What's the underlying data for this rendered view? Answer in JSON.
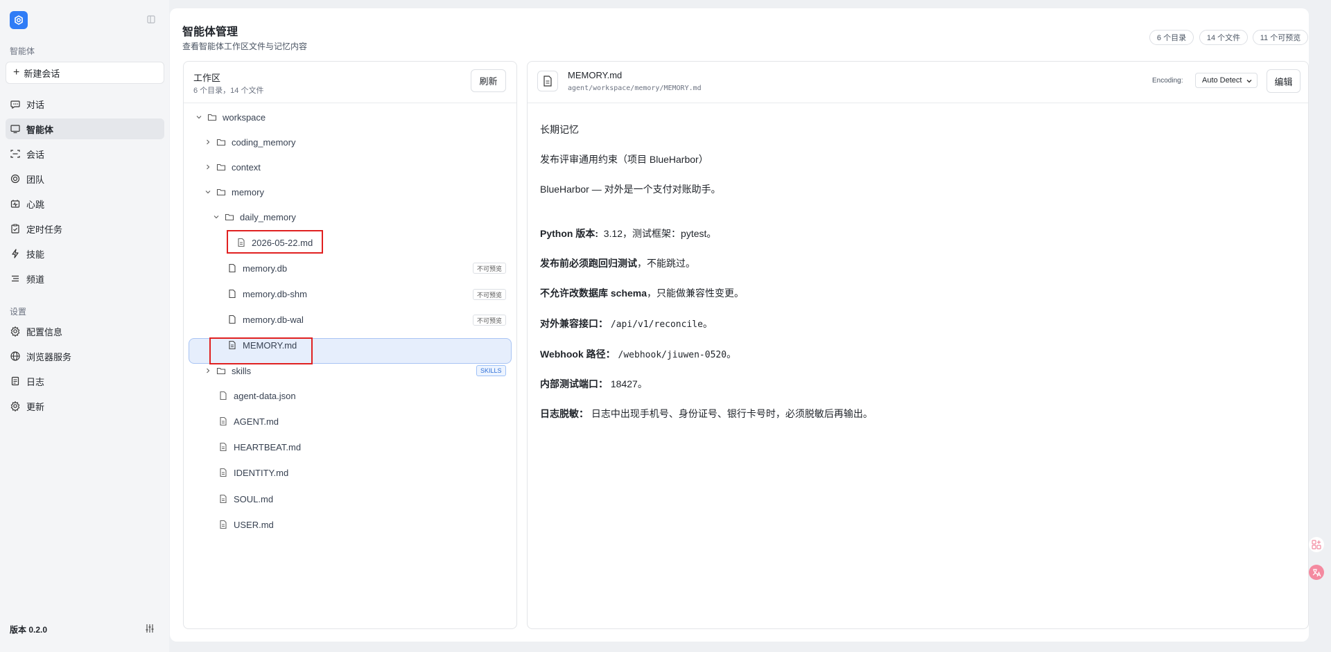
{
  "sidebar": {
    "section_agent": "智能体",
    "new_chat": "新建会话",
    "items": [
      {
        "label": "对话",
        "icon": "chat-bubble-icon"
      },
      {
        "label": "智能体",
        "icon": "monitor-icon"
      },
      {
        "label": "会话",
        "icon": "scan-icon"
      },
      {
        "label": "团队",
        "icon": "team-icon"
      },
      {
        "label": "心跳",
        "icon": "heartbeat-icon"
      },
      {
        "label": "定时任务",
        "icon": "clipboard-check-icon"
      },
      {
        "label": "技能",
        "icon": "lightning-icon"
      },
      {
        "label": "频道",
        "icon": "list-icon"
      }
    ],
    "section_settings": "设置",
    "settings_items": [
      {
        "label": "配置信息",
        "icon": "gear-icon"
      },
      {
        "label": "浏览器服务",
        "icon": "globe-icon"
      },
      {
        "label": "日志",
        "icon": "document-icon"
      },
      {
        "label": "更新",
        "icon": "gear-icon"
      }
    ],
    "version": "版本 0.2.0"
  },
  "header": {
    "title": "智能体管理",
    "subtitle": "查看智能体工作区文件与记忆内容",
    "stats": [
      "6 个目录",
      "14 个文件",
      "11 个可预览"
    ]
  },
  "workspace": {
    "title": "工作区",
    "summary": "6 个目录，14 个文件",
    "refresh_label": "刷新",
    "no_preview_tag": "不可预览",
    "skills_tag": "SKILLS",
    "tree": {
      "workspace": "workspace",
      "coding_memory": "coding_memory",
      "context": "context",
      "memory": "memory",
      "daily_memory": "daily_memory",
      "daily_file": "2026-05-22.md",
      "memory_db": "memory.db",
      "memory_db_shm": "memory.db-shm",
      "memory_db_wal": "memory.db-wal",
      "memory_md": "MEMORY.md",
      "skills": "skills",
      "agent_data": "agent-data.json",
      "agent_md": "AGENT.md",
      "heartbeat_md": "HEARTBEAT.md",
      "identity_md": "IDENTITY.md",
      "soul_md": "SOUL.md",
      "user_md": "USER.md"
    }
  },
  "viewer": {
    "file_name": "MEMORY.md",
    "file_path": "agent/workspace/memory/MEMORY.md",
    "encoding_label": "Encoding:",
    "encoding_value": "Auto Detect",
    "edit_label": "编辑",
    "content": {
      "h1": "长期记忆",
      "h2": "发布评审通用约束（项目 BlueHarbor）",
      "intro": "BlueHarbor — 对外是一个支付对账助手。",
      "python_key": "Python 版本:",
      "python_val": "3.12，测试框架：pytest。",
      "regress_key": "发布前必须跑回归测试",
      "regress_val": "，不能跳过。",
      "schema_key": "不允许改数据库 schema",
      "schema_val": "，只能做兼容性变更。",
      "api_key": "对外兼容接口：",
      "api_val": "/api/v1/reconcile",
      "api_end": "。",
      "webhook_key": "Webhook 路径：",
      "webhook_val": "/webhook/jiuwen-0520",
      "webhook_end": "。",
      "port_key": "内部测试端口：",
      "port_val": "18427。",
      "log_key": "日志脱敏：",
      "log_val": "日志中出现手机号、身份证号、银行卡号时，必须脱敏后再输出。"
    }
  }
}
